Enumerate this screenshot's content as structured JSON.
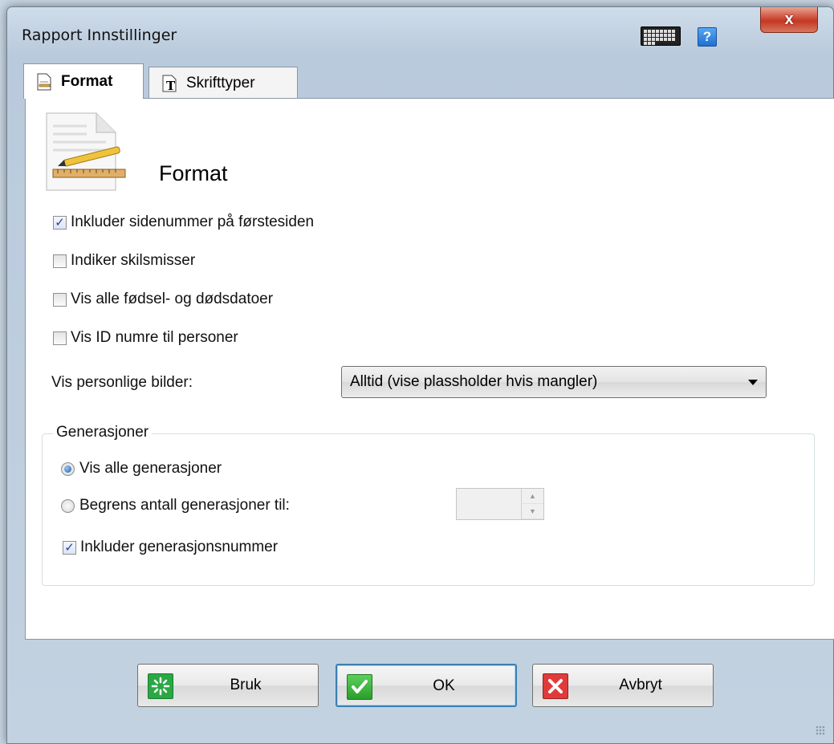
{
  "window": {
    "title": "Rapport Innstillinger",
    "close_label": "x",
    "help_label": "?"
  },
  "tabs": [
    {
      "label": "Format",
      "icon": "format-page-icon",
      "active": true
    },
    {
      "label": "Skrifttyper",
      "icon": "font-type-icon",
      "active": false
    }
  ],
  "panel": {
    "heading": "Format",
    "options": [
      {
        "label": "Inkluder sidenummer på førstesiden",
        "checked": true
      },
      {
        "label": "Indiker skilsmisser",
        "checked": false
      },
      {
        "label": "Vis alle fødsel- og dødsdatoer",
        "checked": false
      },
      {
        "label": "Vis ID numre til personer",
        "checked": false
      }
    ],
    "photos": {
      "label": "Vis personlige bilder:",
      "selected": "Alltid (vise plassholder hvis mangler)"
    },
    "generations": {
      "title": "Generasjoner",
      "radio_all": "Vis alle generasjoner",
      "radio_limit": "Begrens antall generasjoner til:",
      "include_number": "Inkluder generasjonsnummer",
      "spin_up": "▲",
      "spin_down": "▼"
    }
  },
  "buttons": {
    "apply": "Bruk",
    "ok": "OK",
    "cancel": "Avbryt"
  },
  "colors": {
    "accent": "#3c7fb1",
    "ok_green": "#2a9e2a",
    "cancel_red": "#e03b3b"
  }
}
